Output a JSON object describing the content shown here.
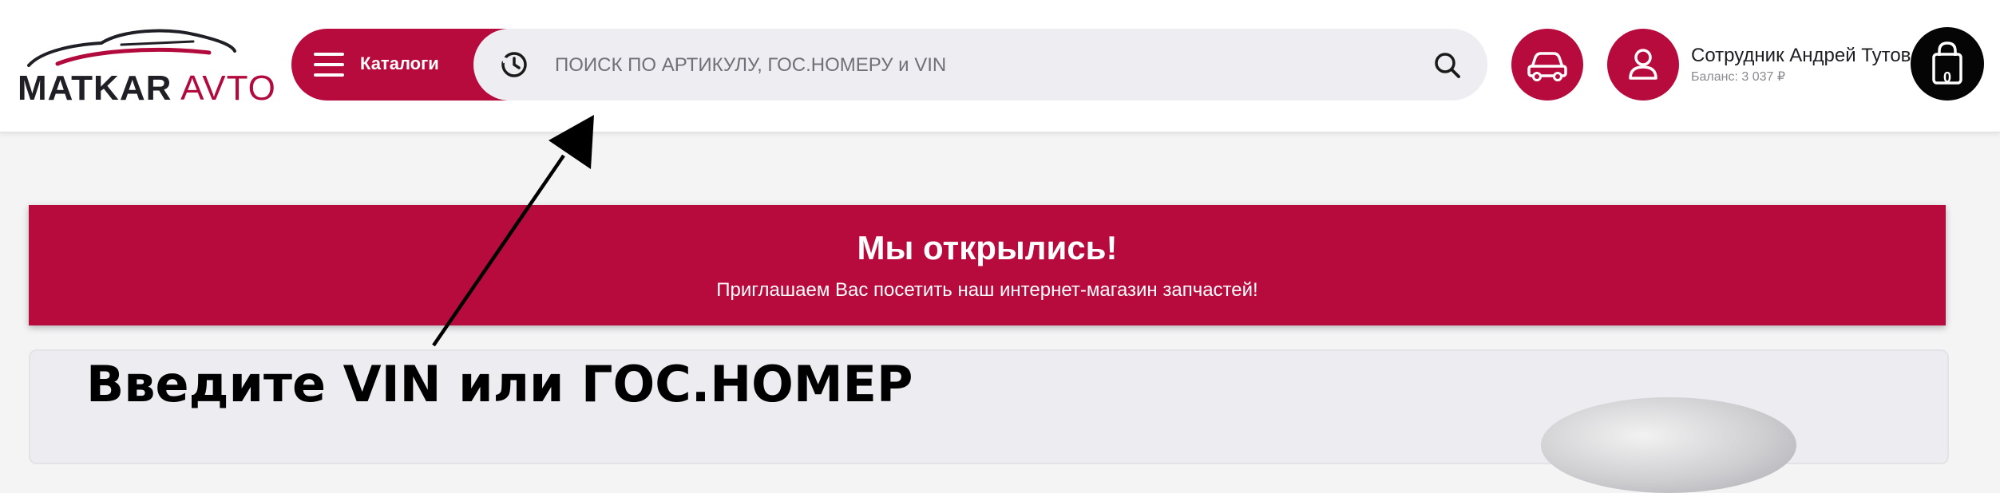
{
  "header": {
    "logo": {
      "word1": "MATKAR",
      "word2": "AVTO"
    },
    "catalog_button": {
      "label": "Каталоги"
    },
    "search": {
      "placeholder": "ПОИСК ПО АРТИКУЛУ, ГОС.НОМЕРУ и VIN",
      "value": ""
    },
    "user": {
      "name": "Сотрудник Андрей Тутов",
      "balance": "Баланс: 3 037 ₽"
    },
    "cart": {
      "count": "0"
    }
  },
  "banner": {
    "title": "Мы открылись!",
    "subtitle": "Приглашаем Вас посетить наш интернет-магазин запчастей!"
  },
  "annotation": {
    "text": "Введите VIN или ГОС.НОМЕР"
  },
  "icons": {
    "menu": "burger-icon",
    "history": "history-icon",
    "search": "search-icon",
    "garage": "car-icon",
    "profile": "user-icon",
    "cart": "bag-icon"
  },
  "colors": {
    "brand": "#b70a3d",
    "header_bg": "#ffffff",
    "search_bg": "#ededf2",
    "page_bg": "#f4f4f5",
    "cart_bg": "#050505"
  }
}
